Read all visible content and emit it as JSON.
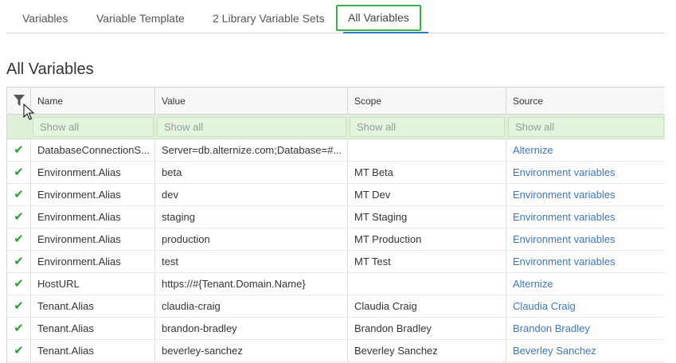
{
  "tabs": [
    {
      "label": "Variables"
    },
    {
      "label": "Variable Template"
    },
    {
      "label": "2 Library Variable Sets"
    },
    {
      "label": "All Variables"
    }
  ],
  "page_title": "All Variables",
  "table": {
    "headers": [
      "Name",
      "Value",
      "Scope",
      "Source"
    ],
    "filter_placeholder": "Show all",
    "rows": [
      {
        "name": "DatabaseConnectionS...",
        "value": "Server=db.alternize.com;Database=#...",
        "scope": "",
        "source": "Alternize"
      },
      {
        "name": "Environment.Alias",
        "value": "beta",
        "scope": "MT Beta",
        "source": "Environment variables"
      },
      {
        "name": "Environment.Alias",
        "value": "dev",
        "scope": "MT Dev",
        "source": "Environment variables"
      },
      {
        "name": "Environment.Alias",
        "value": "staging",
        "scope": "MT Staging",
        "source": "Environment variables"
      },
      {
        "name": "Environment.Alias",
        "value": "production",
        "scope": "MT Production",
        "source": "Environment variables"
      },
      {
        "name": "Environment.Alias",
        "value": "test",
        "scope": "MT Test",
        "source": "Environment variables"
      },
      {
        "name": "HostURL",
        "value": "https://#{Tenant.Domain.Name}",
        "scope": "",
        "source": "Alternize"
      },
      {
        "name": "Tenant.Alias",
        "value": "claudia-craig",
        "scope": "Claudia Craig",
        "source": "Claudia Craig"
      },
      {
        "name": "Tenant.Alias",
        "value": "brandon-bradley",
        "scope": "Brandon Bradley",
        "source": "Brandon Bradley"
      },
      {
        "name": "Tenant.Alias",
        "value": "beverley-sanchez",
        "scope": "Beverley Sanchez",
        "source": "Beverley Sanchez"
      }
    ]
  },
  "colors": {
    "accent_green": "#3bb04c",
    "link_blue": "#3f77b5",
    "filter_bg": "#dff0d8",
    "tab_underline": "#2f78c4"
  },
  "icons": {
    "filter": "filter-icon",
    "check": "checkmark-icon"
  }
}
